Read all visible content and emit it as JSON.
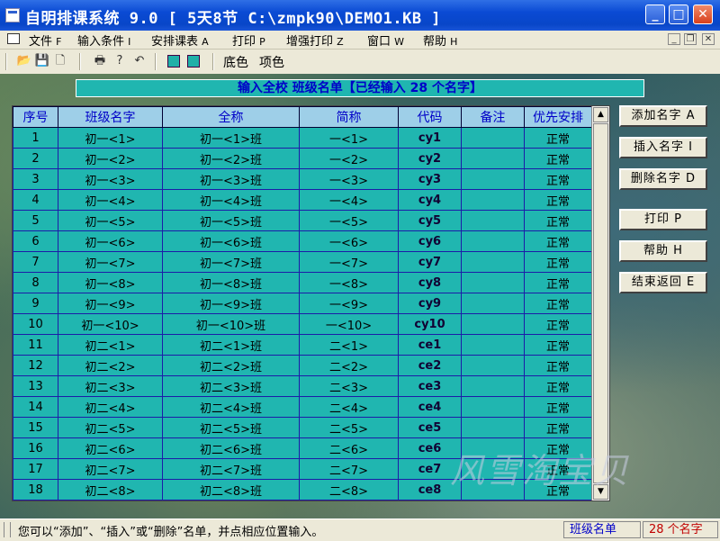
{
  "window": {
    "title": "自明排课系统 9.0 [ 5天8节 C:\\zmpk90\\DEMO1.KB ]",
    "minimize_glyph": "_",
    "maximize_glyph": "□",
    "close_glyph": "✕"
  },
  "menu": {
    "items": [
      {
        "label": "文件",
        "acc": "F"
      },
      {
        "label": "输入条件",
        "acc": "I"
      },
      {
        "label": "安排课表",
        "acc": "A"
      },
      {
        "label": "打印",
        "acc": "P"
      },
      {
        "label": "增强打印",
        "acc": "Z"
      },
      {
        "label": "窗口",
        "acc": "W"
      },
      {
        "label": "帮助",
        "acc": "H"
      }
    ],
    "mdi_min": "_",
    "mdi_restore": "❐",
    "mdi_close": "✕"
  },
  "toolbar": {
    "icons": [
      "open-folder-icon",
      "save-icon",
      "new-file-icon",
      "print-icon",
      "help-icon",
      "undo-icon",
      "bgcolor-icon",
      "itemcolor-icon"
    ],
    "bg_color_label": "底色",
    "item_color_label": "项色"
  },
  "banner": {
    "text": "输入全校  班级名单【已经输入  28  个名字】"
  },
  "table": {
    "columns": [
      "序号",
      "班级名字",
      "全称",
      "简称",
      "代码",
      "备注",
      "优先安排"
    ],
    "rows": [
      [
        "1",
        "初一<1>",
        "初一<1>班",
        "一<1>",
        "cy1",
        "",
        "正常"
      ],
      [
        "2",
        "初一<2>",
        "初一<2>班",
        "一<2>",
        "cy2",
        "",
        "正常"
      ],
      [
        "3",
        "初一<3>",
        "初一<3>班",
        "一<3>",
        "cy3",
        "",
        "正常"
      ],
      [
        "4",
        "初一<4>",
        "初一<4>班",
        "一<4>",
        "cy4",
        "",
        "正常"
      ],
      [
        "5",
        "初一<5>",
        "初一<5>班",
        "一<5>",
        "cy5",
        "",
        "正常"
      ],
      [
        "6",
        "初一<6>",
        "初一<6>班",
        "一<6>",
        "cy6",
        "",
        "正常"
      ],
      [
        "7",
        "初一<7>",
        "初一<7>班",
        "一<7>",
        "cy7",
        "",
        "正常"
      ],
      [
        "8",
        "初一<8>",
        "初一<8>班",
        "一<8>",
        "cy8",
        "",
        "正常"
      ],
      [
        "9",
        "初一<9>",
        "初一<9>班",
        "一<9>",
        "cy9",
        "",
        "正常"
      ],
      [
        "10",
        "初一<10>",
        "初一<10>班",
        "一<10>",
        "cy10",
        "",
        "正常"
      ],
      [
        "11",
        "初二<1>",
        "初二<1>班",
        "二<1>",
        "ce1",
        "",
        "正常"
      ],
      [
        "12",
        "初二<2>",
        "初二<2>班",
        "二<2>",
        "ce2",
        "",
        "正常"
      ],
      [
        "13",
        "初二<3>",
        "初二<3>班",
        "二<3>",
        "ce3",
        "",
        "正常"
      ],
      [
        "14",
        "初二<4>",
        "初二<4>班",
        "二<4>",
        "ce4",
        "",
        "正常"
      ],
      [
        "15",
        "初二<5>",
        "初二<5>班",
        "二<5>",
        "ce5",
        "",
        "正常"
      ],
      [
        "16",
        "初二<6>",
        "初二<6>班",
        "二<6>",
        "ce6",
        "",
        "正常"
      ],
      [
        "17",
        "初二<7>",
        "初二<7>班",
        "二<7>",
        "ce7",
        "",
        "正常"
      ],
      [
        "18",
        "初二<8>",
        "初二<8>班",
        "二<8>",
        "ce8",
        "",
        "正常"
      ]
    ],
    "scroll_up": "▲",
    "scroll_down": "▼"
  },
  "side_buttons": [
    {
      "label": "添加名字 A",
      "name": "add-name-button"
    },
    {
      "label": "插入名字 I",
      "name": "insert-name-button"
    },
    {
      "label": "删除名字 D",
      "name": "delete-name-button"
    },
    {
      "label": "打印 P",
      "name": "print-button"
    },
    {
      "label": "帮助 H",
      "name": "help-button"
    },
    {
      "label": "结束返回 E",
      "name": "exit-return-button"
    }
  ],
  "watermark": "风雪淘宝贝",
  "status": {
    "message": "您可以“添加”、“插入”或“删除”名单，并点相应位置输入。",
    "list_name": "班级名单",
    "count": "28 个名字"
  }
}
